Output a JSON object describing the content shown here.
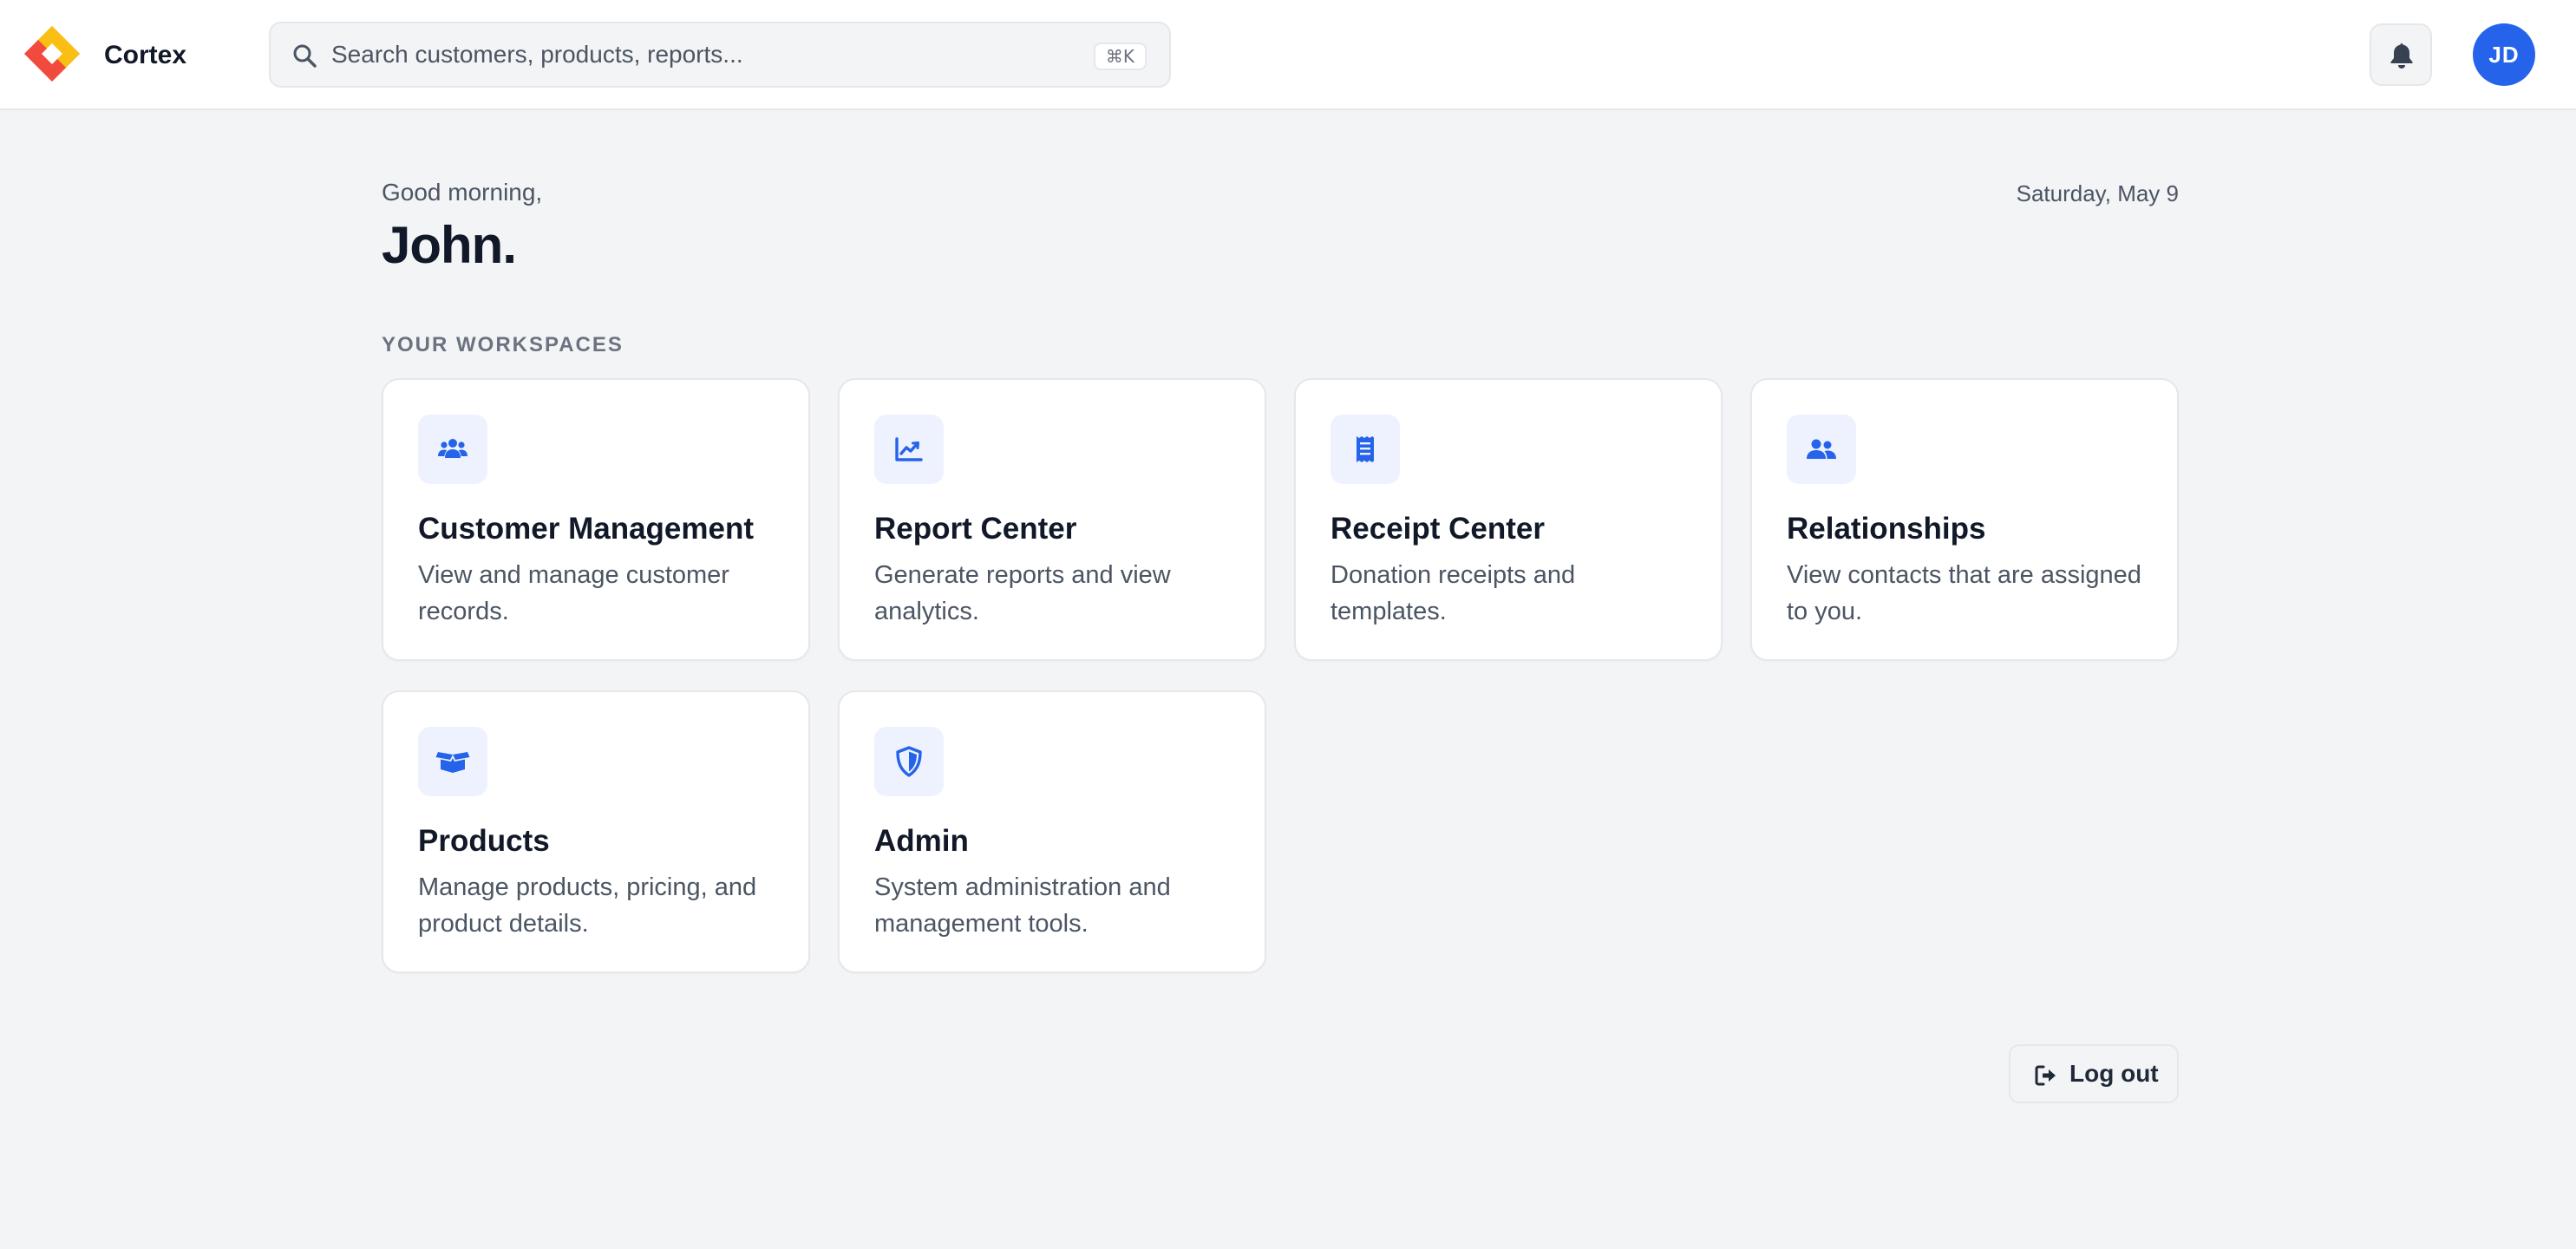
{
  "app": {
    "brand": "Cortex",
    "accent_color": "#2563eb"
  },
  "header": {
    "search": {
      "placeholder": "Search customers, products, reports...",
      "shortcut": "⌘K",
      "icon": "search-icon"
    },
    "notifications_icon": "bell-icon",
    "avatar_initials": "JD"
  },
  "main": {
    "greeting": "Good morning,",
    "user_name": "John.",
    "date": "Saturday, May 9",
    "section_label": "YOUR WORKSPACES",
    "workspaces": [
      {
        "title": "Customer Management",
        "description": "View and manage customer records.",
        "icon": "users-icon"
      },
      {
        "title": "Report Center",
        "description": "Generate reports and view analytics.",
        "icon": "chart-line-icon"
      },
      {
        "title": "Receipt Center",
        "description": "Donation receipts and templates.",
        "icon": "receipt-icon"
      },
      {
        "title": "Relationships",
        "description": "View contacts that are assigned to you.",
        "icon": "user-group-icon"
      },
      {
        "title": "Products",
        "description": "Manage products, pricing, and product details.",
        "icon": "box-open-icon"
      },
      {
        "title": "Admin",
        "description": "System administration and management tools.",
        "icon": "shield-icon"
      }
    ],
    "logout_label": "Log out",
    "logout_icon": "sign-out-icon"
  }
}
